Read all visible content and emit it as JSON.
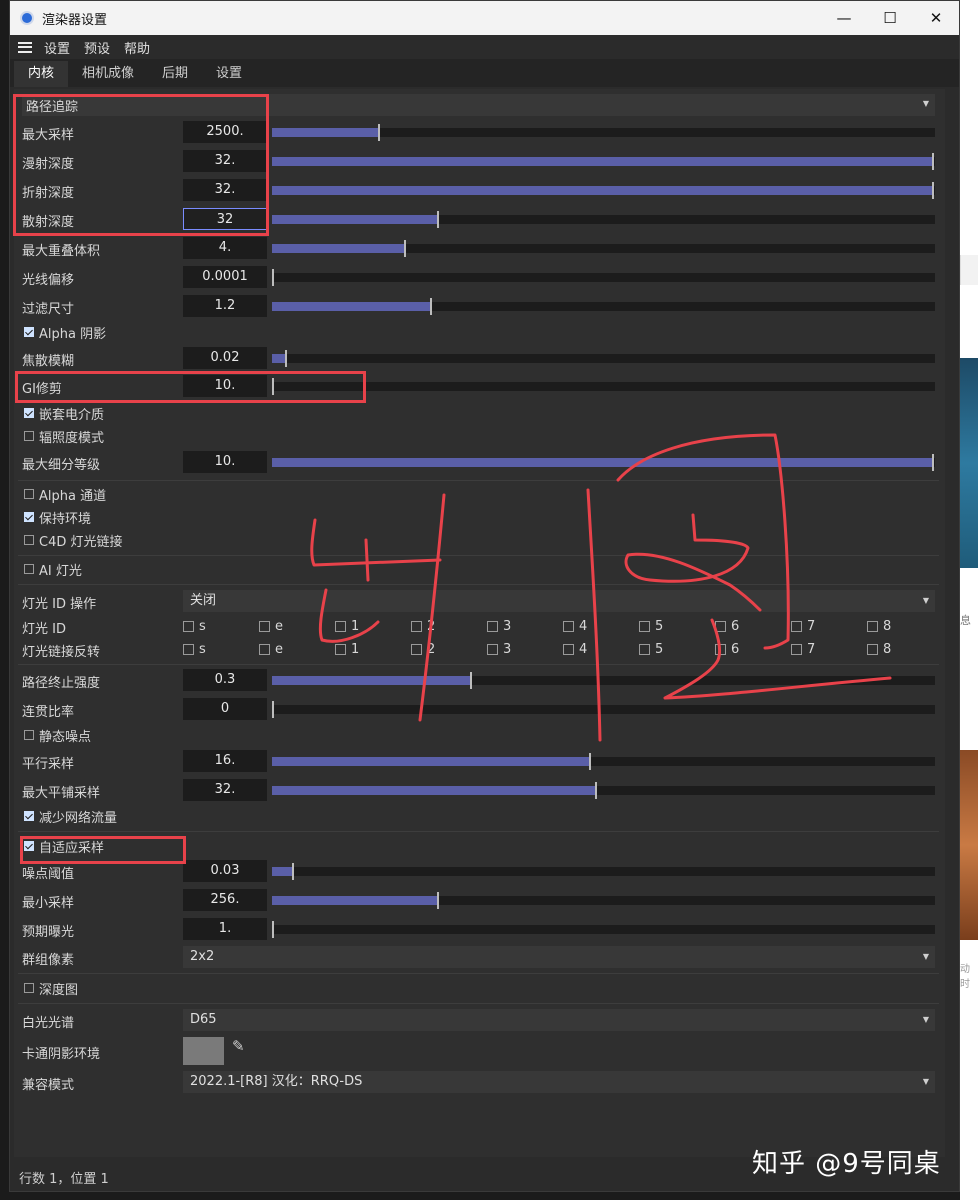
{
  "window": {
    "title": "渲染器设置",
    "minimize": "—",
    "maximize": "☐",
    "close": "✕"
  },
  "menu": [
    "设置",
    "预设",
    "帮助"
  ],
  "tabs": [
    "内核",
    "相机成像",
    "后期",
    "设置"
  ],
  "active_tab": "内核",
  "section": "路径追踪",
  "params": {
    "max_samples": {
      "label": "最大采样",
      "value": "2500.",
      "fraction": 0.16
    },
    "diffuse_depth": {
      "label": "漫射深度",
      "value": "32.",
      "fraction": 1.0
    },
    "refraction_depth": {
      "label": "折射深度",
      "value": "32.",
      "fraction": 1.0
    },
    "scatter_depth": {
      "label": "散射深度",
      "value": "32",
      "fraction": 0.25
    },
    "max_overlap": {
      "label": "最大重叠体积",
      "value": "4.",
      "fraction": 0.2
    },
    "ray_epsilon": {
      "label": "光线偏移",
      "value": "0.0001",
      "fraction": 0.0
    },
    "filter_size": {
      "label": "过滤尺寸",
      "value": "1.2",
      "fraction": 0.24
    },
    "alpha_shadow": {
      "label": "Alpha 阴影",
      "checked": true
    },
    "caustic_blur": {
      "label": "焦散模糊",
      "value": "0.02",
      "fraction": 0.02
    },
    "gi_clamp": {
      "label": "GI修剪",
      "value": "10.",
      "fraction": 0.0
    },
    "nested_dielectric": {
      "label": "嵌套电介质",
      "checked": true
    },
    "irradiance_mode": {
      "label": "辐照度模式",
      "checked": false
    },
    "max_subdiv": {
      "label": "最大细分等级",
      "value": "10.",
      "fraction": 1.0
    },
    "alpha_channel": {
      "label": "Alpha 通道",
      "checked": false
    },
    "keep_env": {
      "label": "保持环境",
      "checked": true
    },
    "c4d_light_link": {
      "label": "C4D 灯光链接",
      "checked": false
    },
    "ai_light": {
      "label": "AI 灯光",
      "checked": false
    },
    "light_id_action": {
      "label": "灯光 ID 操作",
      "value": "关闭"
    },
    "light_id": {
      "label": "灯光 ID"
    },
    "light_link_invert": {
      "label": "灯光链接反转"
    },
    "path_term": {
      "label": "路径终止强度",
      "value": "0.3",
      "fraction": 0.3
    },
    "coherent_ratio": {
      "label": "连贯比率",
      "value": "0",
      "fraction": 0.0
    },
    "static_noise": {
      "label": "静态噪点",
      "checked": false
    },
    "parallel_samples": {
      "label": "平行采样",
      "value": "16.",
      "fraction": 0.48
    },
    "max_tile_samples": {
      "label": "最大平铺采样",
      "value": "32.",
      "fraction": 0.49
    },
    "reduce_net": {
      "label": "减少网络流量",
      "checked": true
    },
    "adaptive": {
      "label": "自适应采样",
      "checked": true
    },
    "noise_threshold": {
      "label": "噪点阈值",
      "value": "0.03",
      "fraction": 0.03
    },
    "min_samples": {
      "label": "最小采样",
      "value": "256.",
      "fraction": 0.25
    },
    "expected_exposure": {
      "label": "预期曝光",
      "value": "1.",
      "fraction": 0.0
    },
    "group_pixels": {
      "label": "群组像素",
      "value": "2x2"
    },
    "depth_map": {
      "label": "深度图",
      "checked": false
    },
    "white_spectrum": {
      "label": "白光光谱",
      "value": "D65"
    },
    "toon_shadow_env": {
      "label": "卡通阴影环境"
    },
    "compat_mode": {
      "label": "兼容模式",
      "value": "2022.1-[R8]   汉化：RRQ-DS"
    }
  },
  "light_id_options": [
    "s",
    "e",
    "1",
    "2",
    "3",
    "4",
    "5",
    "6",
    "7",
    "8"
  ],
  "status": "行数 1，位置 1",
  "watermark": "知乎 @9号同桌",
  "side_text": "息",
  "side_text2": "动时",
  "colors": {
    "slider_fill": "#5a5fa8",
    "annotation": "#e8424a"
  }
}
